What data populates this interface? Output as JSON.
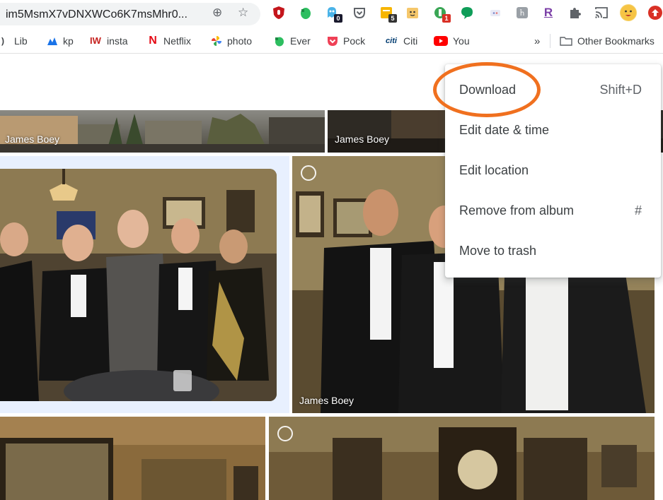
{
  "browser": {
    "url_fragment": "im5MsmX7vDNXWCo6K7msMhr0...",
    "extension_badges": {
      "ghost": "0",
      "notes": "5",
      "green": "1"
    },
    "brand_letter_r": "R"
  },
  "bookmarks": {
    "items": [
      {
        "label": "Lib",
        "icon": "chevron-fragment-icon"
      },
      {
        "label": "kp",
        "icon": "kp-icon"
      },
      {
        "label": "insta",
        "icon": "iw-icon",
        "icon_text": "IW"
      },
      {
        "label": "Netflix",
        "icon": "netflix-icon",
        "icon_text": "N"
      },
      {
        "label": "photo",
        "icon": "photos-pinwheel-icon"
      },
      {
        "label": "Ever",
        "icon": "evernote-icon"
      },
      {
        "label": "Pock",
        "icon": "pocket-icon"
      },
      {
        "label": "Citi",
        "icon": "citi-icon",
        "icon_text": "citi"
      },
      {
        "label": "You",
        "icon": "youtube-icon"
      }
    ],
    "overflow_label": "»",
    "other_label": "Other Bookmarks"
  },
  "photos": {
    "captions": [
      "James Boey",
      "James Boey",
      "James Boey"
    ]
  },
  "menu": {
    "items": [
      {
        "label": "Download",
        "shortcut": "Shift+D"
      },
      {
        "label": "Edit date & time",
        "shortcut": ""
      },
      {
        "label": "Edit location",
        "shortcut": ""
      },
      {
        "label": "Remove from album",
        "shortcut": "#"
      },
      {
        "label": "Move to trash",
        "shortcut": ""
      }
    ]
  },
  "colors": {
    "highlight_ring": "#f0701f",
    "selected_photo_bg": "#e8f0fe"
  }
}
